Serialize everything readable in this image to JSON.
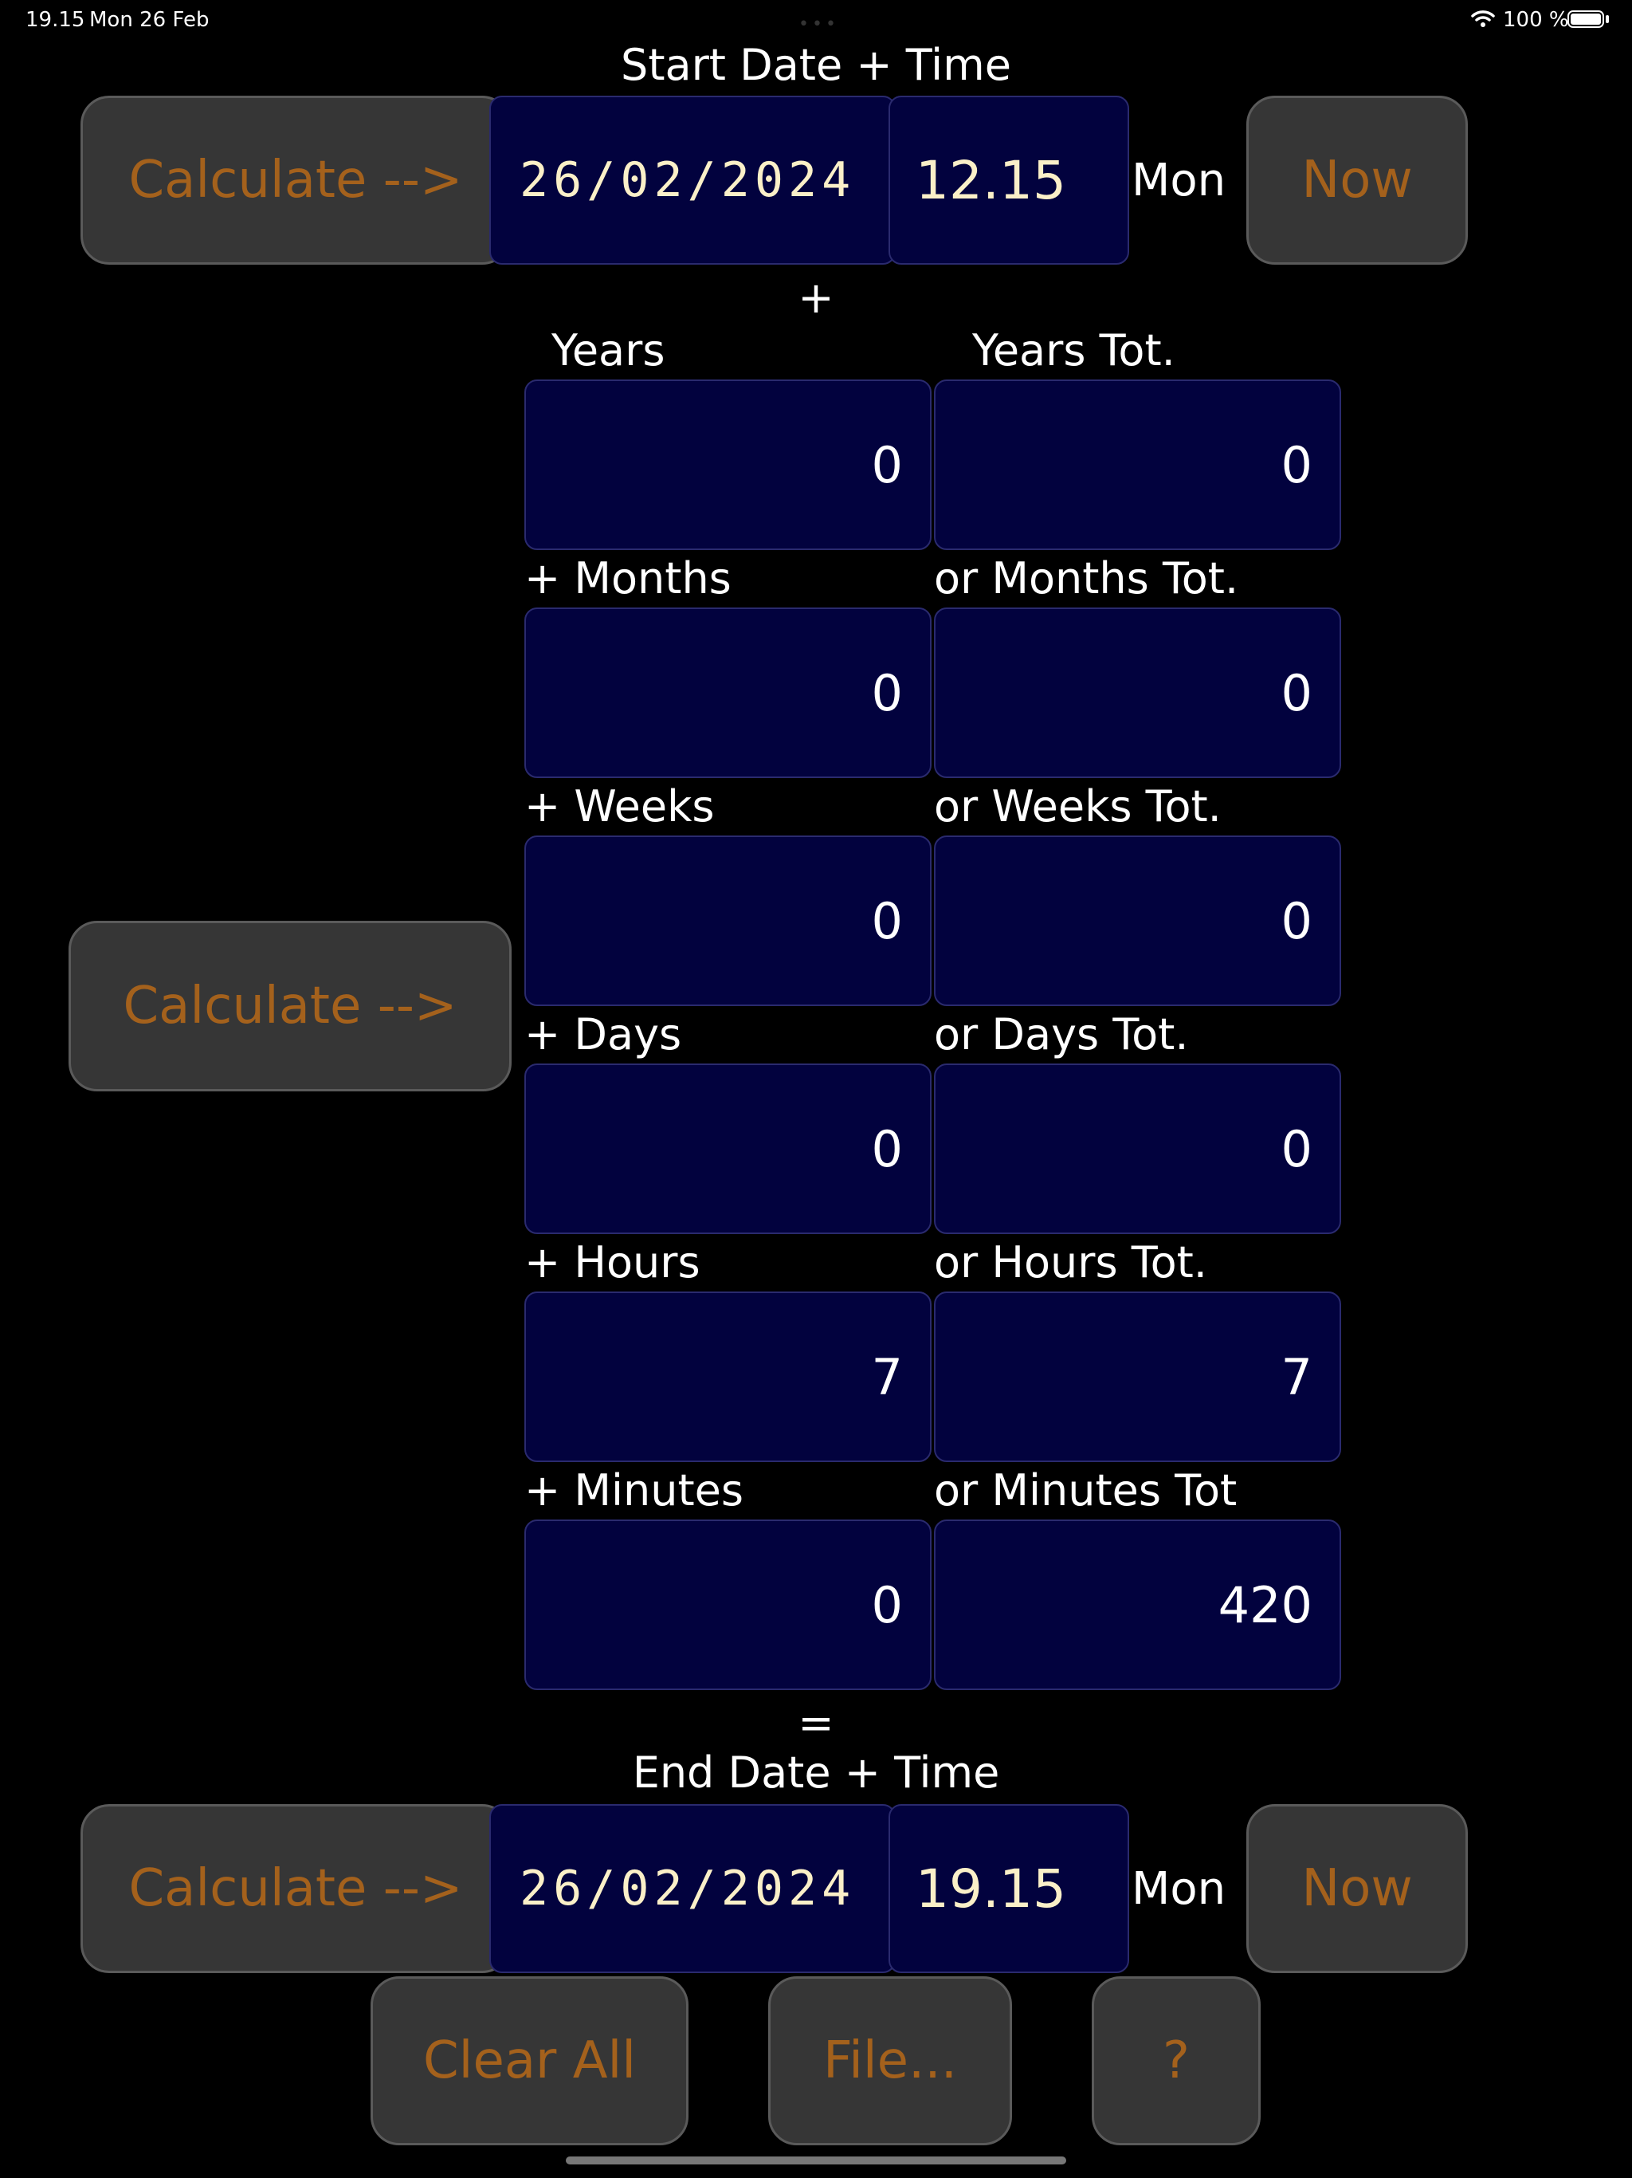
{
  "status_bar": {
    "time": "19.15",
    "date": "Mon 26 Feb",
    "battery": "100 %"
  },
  "start": {
    "title": "Start Date + Time",
    "calculate_label": "Calculate -->",
    "date": "26/02/2024",
    "time": "12.15",
    "weekday": "Mon",
    "now_label": "Now"
  },
  "plus_sign": "+",
  "middle_calculate_label": "Calculate -->",
  "rows": [
    {
      "left_label": "Years",
      "right_label": "Years Tot.",
      "left_value": "0",
      "right_value": "0"
    },
    {
      "left_label": "+ Months",
      "right_label": "or Months Tot.",
      "left_value": "0",
      "right_value": "0"
    },
    {
      "left_label": "+ Weeks",
      "right_label": "or Weeks Tot.",
      "left_value": "0",
      "right_value": "0"
    },
    {
      "left_label": "+ Days",
      "right_label": "or Days Tot.",
      "left_value": "0",
      "right_value": "0"
    },
    {
      "left_label": "+ Hours",
      "right_label": "or Hours Tot.",
      "left_value": "7",
      "right_value": "7"
    },
    {
      "left_label": "+ Minutes",
      "right_label": "or Minutes Tot",
      "left_value": "0",
      "right_value": "420"
    }
  ],
  "equals_sign": "=",
  "end": {
    "title": "End Date + Time",
    "calculate_label": "Calculate -->",
    "date": "26/02/2024",
    "time": "19.15",
    "weekday": "Mon",
    "now_label": "Now"
  },
  "bottom": {
    "clear_label": "Clear All",
    "file_label": "File...",
    "help_label": "?"
  },
  "colors": {
    "background": "#000000",
    "field": "#02023e",
    "button": "#363636",
    "button_text": "#a4611c",
    "date_text": "#fbf0c8"
  },
  "icons": [
    "wifi-icon",
    "battery-icon"
  ]
}
